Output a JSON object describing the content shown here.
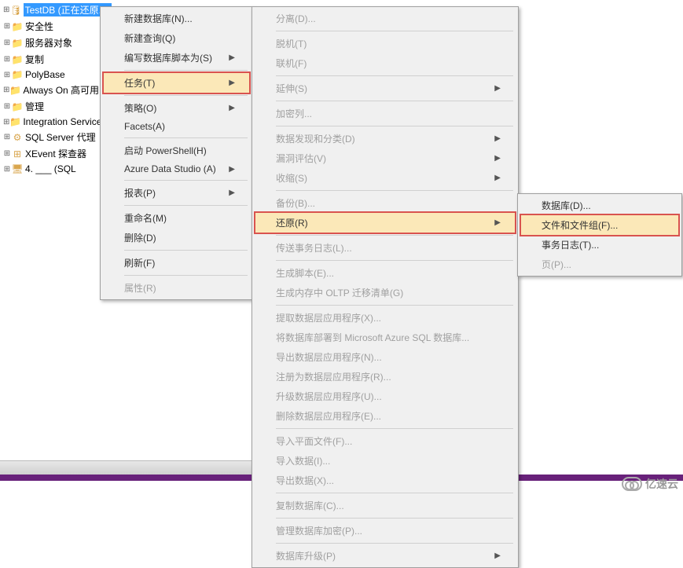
{
  "tree": {
    "selected_db": "TestDB",
    "selected_suffix": " (正在还原...)",
    "items": [
      "安全性",
      "服务器对象",
      "复制",
      "PolyBase",
      "Always On 高可用",
      "管理",
      "Integration Services",
      "SQL Server 代理",
      "XEvent 探查器",
      "4. ___ (SQL"
    ]
  },
  "menu1": {
    "items": [
      {
        "label": "新建数据库(N)..."
      },
      {
        "label": "新建查询(Q)"
      },
      {
        "label": "编写数据库脚本为(S)",
        "arrow": true
      },
      {
        "label": "任务(T)",
        "arrow": true,
        "hl": true
      },
      {
        "label": "策略(O)",
        "arrow": true
      },
      {
        "label": "Facets(A)"
      },
      {
        "label": "启动 PowerShell(H)"
      },
      {
        "label": "Azure Data Studio (A)",
        "arrow": true
      },
      {
        "label": "报表(P)",
        "arrow": true
      },
      {
        "label": "重命名(M)"
      },
      {
        "label": "删除(D)"
      },
      {
        "label": "刷新(F)"
      },
      {
        "label": "属性(R)",
        "disabled": true
      }
    ]
  },
  "menu2": {
    "items": [
      {
        "label": "分离(D)...",
        "disabled": true
      },
      {
        "label": "脱机(T)",
        "disabled": true
      },
      {
        "label": "联机(F)",
        "disabled": true
      },
      {
        "label": "延伸(S)",
        "arrow": true,
        "disabled": true
      },
      {
        "label": "加密列...",
        "disabled": true
      },
      {
        "label": "数据发现和分类(D)",
        "arrow": true,
        "disabled": true
      },
      {
        "label": "漏洞评估(V)",
        "arrow": true,
        "disabled": true
      },
      {
        "label": "收缩(S)",
        "arrow": true,
        "disabled": true
      },
      {
        "label": "备份(B)...",
        "disabled": true
      },
      {
        "label": "还原(R)",
        "arrow": true,
        "hl": true
      },
      {
        "label": "传送事务日志(L)...",
        "disabled": true
      },
      {
        "label": "生成脚本(E)...",
        "disabled": true
      },
      {
        "label": "生成内存中 OLTP 迁移清单(G)",
        "disabled": true
      },
      {
        "label": "提取数据层应用程序(X)...",
        "disabled": true
      },
      {
        "label": "将数据库部署到 Microsoft Azure SQL 数据库...",
        "disabled": true
      },
      {
        "label": "导出数据层应用程序(N)...",
        "disabled": true
      },
      {
        "label": "注册为数据层应用程序(R)...",
        "disabled": true
      },
      {
        "label": "升级数据层应用程序(U)...",
        "disabled": true
      },
      {
        "label": "删除数据层应用程序(E)...",
        "disabled": true
      },
      {
        "label": "导入平面文件(F)...",
        "disabled": true
      },
      {
        "label": "导入数据(I)...",
        "disabled": true
      },
      {
        "label": "导出数据(X)...",
        "disabled": true
      },
      {
        "label": "复制数据库(C)...",
        "disabled": true
      },
      {
        "label": "管理数据库加密(P)...",
        "disabled": true
      },
      {
        "label": "数据库升级(P)",
        "arrow": true,
        "disabled": true
      }
    ],
    "seps_after": [
      0,
      2,
      3,
      4,
      7,
      9,
      10,
      12,
      18,
      21,
      22,
      23
    ]
  },
  "menu3": {
    "items": [
      {
        "label": "数据库(D)..."
      },
      {
        "label": "文件和文件组(F)...",
        "hl": true
      },
      {
        "label": "事务日志(T)..."
      },
      {
        "label": "页(P)...",
        "disabled": true
      }
    ]
  },
  "watermark": "亿速云"
}
